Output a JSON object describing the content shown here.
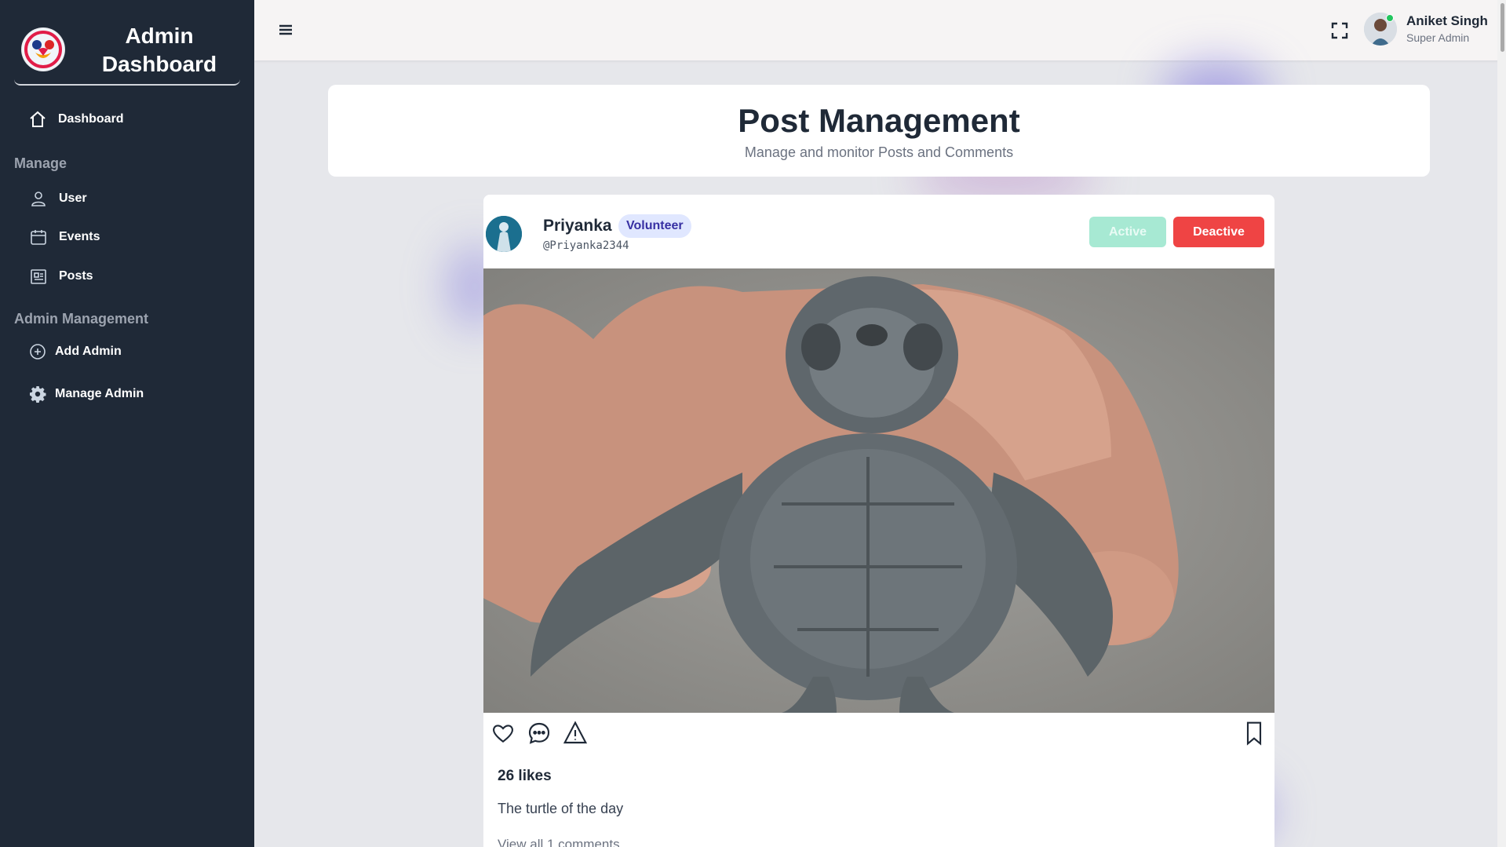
{
  "sidebar": {
    "brand_title": "Admin Dashboard",
    "dashboard_label": "Dashboard",
    "manage_heading": "Manage",
    "items": [
      {
        "label": "User",
        "icon": "user-icon"
      },
      {
        "label": "Events",
        "icon": "calendar-icon"
      },
      {
        "label": "Posts",
        "icon": "posts-icon"
      }
    ],
    "admin_heading": "Admin Management",
    "admin_items": [
      {
        "label": "Add Admin",
        "icon": "plus-circle-icon"
      },
      {
        "label": "Manage Admin",
        "icon": "gear-icon"
      }
    ]
  },
  "header": {
    "menu_icon": "hamburger-icon",
    "fullscreen_icon": "fullscreen-icon",
    "user_name": "Aniket Singh",
    "user_role": "Super Admin",
    "status_color": "#22c55e"
  },
  "page": {
    "title": "Post Management",
    "subtitle": "Manage and monitor Posts and Comments"
  },
  "post": {
    "author": "Priyanka",
    "role": "Volunteer",
    "handle": "@Priyanka2344",
    "active_label": "Active",
    "deactive_label": "Deactive",
    "likes": "26 likes",
    "caption": "The turtle of the day",
    "comments_link": "View all 1 comments"
  },
  "colors": {
    "sidebar_bg": "#1f2937",
    "deactive": "#ef4444",
    "active_disabled": "#a7e9d3",
    "badge_bg": "#e0e7ff"
  }
}
